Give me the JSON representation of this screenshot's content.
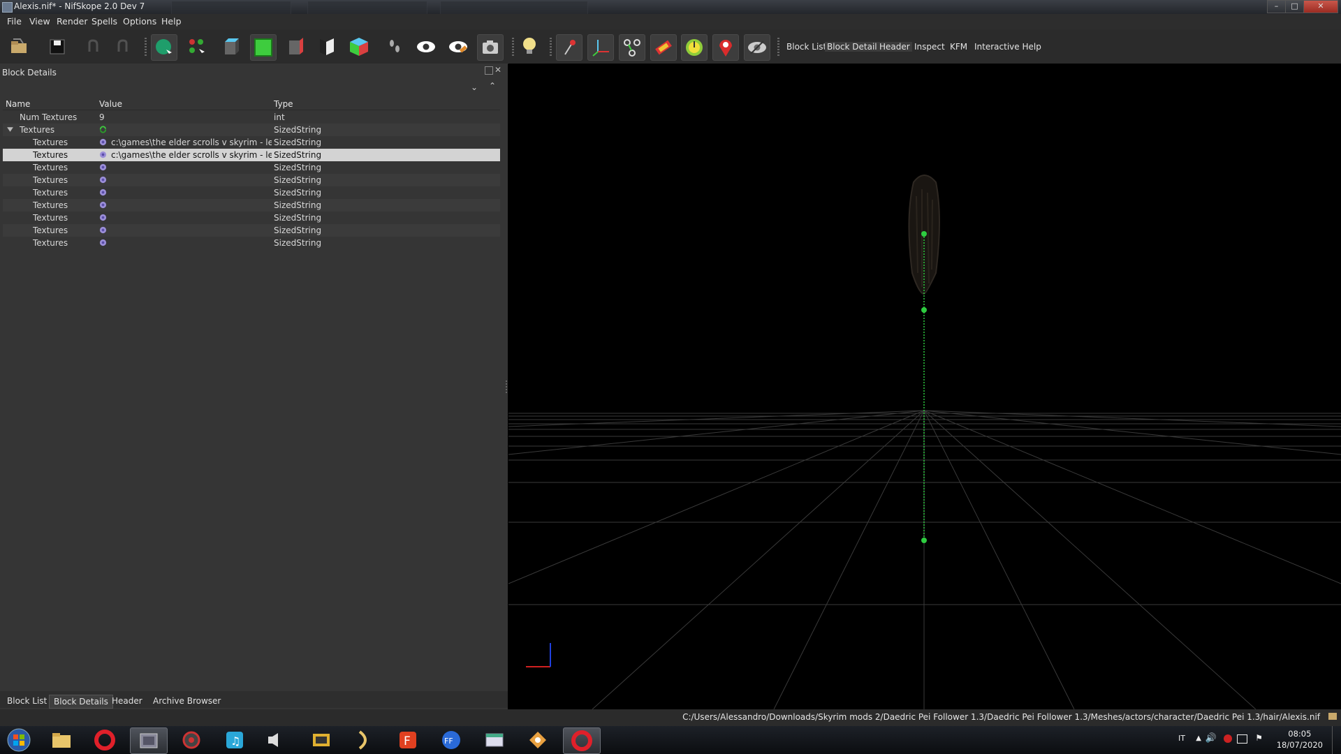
{
  "window": {
    "title": "Alexis.nif* - NifSkope 2.0 Dev 7"
  },
  "menubar": {
    "items": [
      "File",
      "View",
      "Render",
      "Spells",
      "Options",
      "Help"
    ]
  },
  "toolbar": {
    "dock_tabs": [
      "Block List",
      "Block Details",
      "Header",
      "Inspect",
      "KFM",
      "Interactive Help"
    ]
  },
  "panel": {
    "title": "Block Details",
    "columns": [
      "Name",
      "Value",
      "Type"
    ],
    "rows": [
      {
        "name": "Num Textures",
        "value": "9",
        "type": "int"
      },
      {
        "name": "Textures",
        "value": "",
        "type": "SizedString"
      },
      {
        "name": "Textures",
        "value": "c:\\games\\the elder scrolls v skyrim - lege...",
        "type": "SizedString"
      },
      {
        "name": "Textures",
        "value": "c:\\games\\the elder scrolls v skyrim - lege...",
        "type": "SizedString"
      },
      {
        "name": "Textures",
        "value": "",
        "type": "SizedString"
      },
      {
        "name": "Textures",
        "value": "",
        "type": "SizedString"
      },
      {
        "name": "Textures",
        "value": "",
        "type": "SizedString"
      },
      {
        "name": "Textures",
        "value": "",
        "type": "SizedString"
      },
      {
        "name": "Textures",
        "value": "",
        "type": "SizedString"
      },
      {
        "name": "Textures",
        "value": "",
        "type": "SizedString"
      },
      {
        "name": "Textures",
        "value": "",
        "type": "SizedString"
      }
    ],
    "tabs": [
      "Block List",
      "Block Details",
      "Header",
      "Archive Browser"
    ]
  },
  "statusbar": {
    "path": "C:/Users/Alessandro/Downloads/Skyrim mods 2/Daedric Pei Follower 1.3/Daedric Pei Follower 1.3/Meshes/actors/character/Daedric Pei 1.3/hair/Alexis.nif"
  },
  "taskbar": {
    "language": "IT",
    "time": "08:05",
    "date": "18/07/2020"
  },
  "colors": {
    "accent_green": "#2ecc40",
    "selection": "#d3d3d3",
    "panel_bg": "#353535"
  }
}
